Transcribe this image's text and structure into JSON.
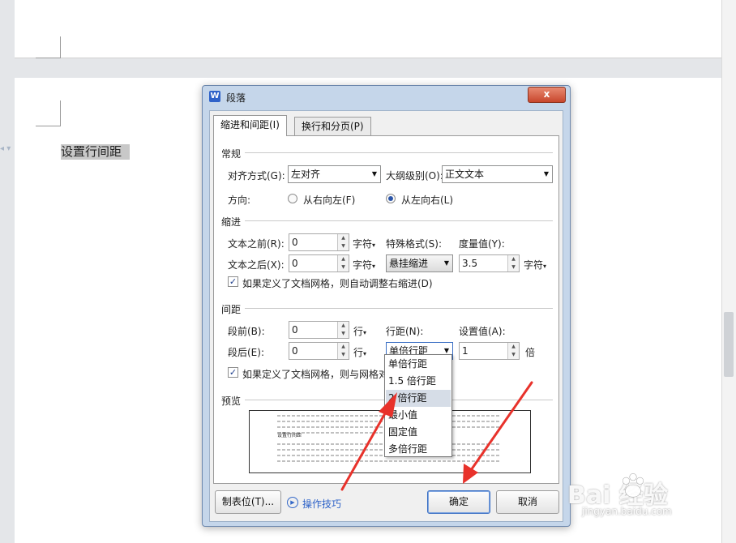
{
  "document": {
    "body_text": "设置行间距"
  },
  "dialog": {
    "title": "段落",
    "app_icon_letter": "W",
    "close_glyph": "x",
    "tabs": [
      {
        "label": "缩进和间距(I)",
        "active": true
      },
      {
        "label": "换行和分页(P)",
        "active": false
      }
    ],
    "general": {
      "section": "常规",
      "alignment_label": "对齐方式(G):",
      "alignment_value": "左对齐",
      "outline_label": "大纲级别(O):",
      "outline_value": "正文文本",
      "direction_label": "方向:",
      "rtl_label": "从右向左(F)",
      "ltr_label": "从左向右(L)"
    },
    "indent": {
      "section": "缩进",
      "before_label": "文本之前(R):",
      "before_value": "0",
      "before_unit": "字符",
      "after_label": "文本之后(X):",
      "after_value": "0",
      "after_unit": "字符",
      "special_label": "特殊格式(S):",
      "special_value": "悬挂缩进",
      "measure_label": "度量值(Y):",
      "measure_value": "3.5",
      "measure_unit": "字符",
      "auto_adjust_label": "如果定义了文档网格，则自动调整右缩进(D)"
    },
    "spacing": {
      "section": "间距",
      "before_label": "段前(B):",
      "before_value": "0",
      "before_unit": "行",
      "after_label": "段后(E):",
      "after_value": "0",
      "after_unit": "行",
      "line_spacing_label": "行距(N):",
      "line_spacing_value": "单倍行距",
      "set_value_label": "设置值(A):",
      "set_value": "1",
      "set_value_unit": "倍",
      "grid_align_label": "如果定义了文档网格，则与网格对"
    },
    "line_spacing_options": [
      "单倍行距",
      "1.5 倍行距",
      "2 倍行距",
      "最小值",
      "固定值",
      "多倍行距"
    ],
    "preview": {
      "section": "预览",
      "sample_text": "设置行间距"
    },
    "buttons": {
      "tabs": "制表位(T)...",
      "tips": "操作技巧",
      "ok": "确定",
      "cancel": "取消"
    }
  },
  "watermark": {
    "brand": "Bai 经验",
    "url": "jingyan.baidu.com"
  },
  "colors": {
    "annotation_arrow": "#e8322b",
    "dialog_frame": "#c5d6ea",
    "link": "#2d62c8"
  },
  "icons": [
    "app-icon",
    "close-icon",
    "chevron-down-icon",
    "spin-up-icon",
    "spin-down-icon",
    "play-circle-icon",
    "paw-icon"
  ]
}
